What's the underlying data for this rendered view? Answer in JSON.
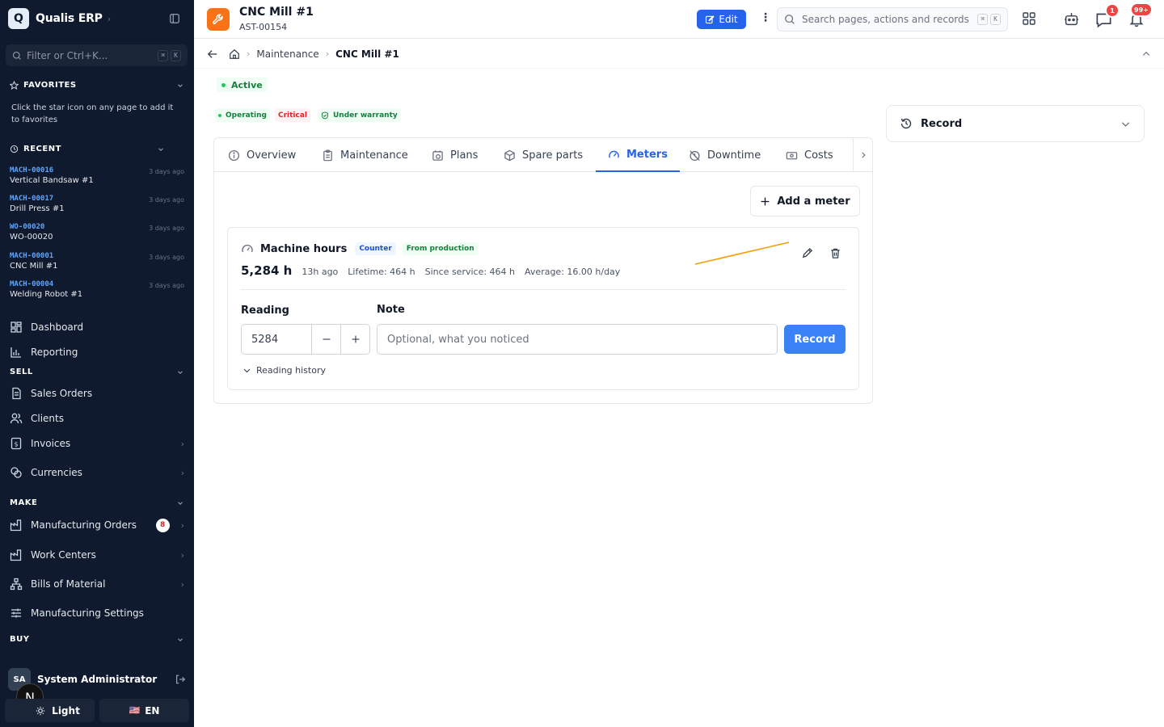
{
  "sidebar": {
    "app_name": "Qualis ERP",
    "logo_letter": "Q",
    "filter_placeholder": "Filter or Ctrl+K...",
    "filter_kbd": [
      "⌘",
      "K"
    ],
    "favorites": {
      "title": "FAVORITES",
      "hint": "Click the star icon on any page to add it to favorites"
    },
    "recent": {
      "title": "RECENT",
      "items": [
        {
          "code": "MACH-00016",
          "name": "Vertical Bandsaw #1",
          "time": "3 days ago"
        },
        {
          "code": "MACH-00017",
          "name": "Drill Press #1",
          "time": "3 days ago"
        },
        {
          "code": "WO-00020",
          "name": "WO-00020",
          "time": "3 days ago"
        },
        {
          "code": "MACH-00001",
          "name": "CNC Mill #1",
          "time": "3 days ago"
        },
        {
          "code": "MACH-00004",
          "name": "Welding Robot #1",
          "time": "3 days ago"
        }
      ]
    },
    "nav": {
      "dashboard": "Dashboard",
      "reporting": "Reporting"
    },
    "sell": {
      "title": "SELL",
      "sales_orders": "Sales Orders",
      "clients": "Clients",
      "invoices": "Invoices",
      "currencies": "Currencies"
    },
    "make": {
      "title": "MAKE",
      "manufacturing_orders": "Manufacturing Orders",
      "manufacturing_orders_badge": "8",
      "work_centers": "Work Centers",
      "bills_of_material": "Bills of Material",
      "manufacturing_settings": "Manufacturing Settings"
    },
    "buy": {
      "title": "BUY"
    },
    "user": {
      "initials": "SA",
      "name": "System Administrator"
    },
    "n_bubble": "N",
    "theme_label": "Light",
    "language_label": "EN",
    "language_flag": "🇺🇸"
  },
  "header": {
    "asset_title": "CNC Mill #1",
    "asset_code": "AST-00154",
    "edit_label": "Edit",
    "search_placeholder": "Search pages, actions and records",
    "search_kbd": [
      "⌘",
      "K"
    ],
    "messages_badge": "1",
    "notifications_badge": "99+"
  },
  "breadcrumb": {
    "items": [
      "Maintenance",
      "CNC Mill #1"
    ]
  },
  "status": {
    "main": "Active",
    "operating": "Operating",
    "criticality": "Critical",
    "warranty": "Under warranty"
  },
  "record_panel": {
    "title": "Record"
  },
  "tabs": [
    "Overview",
    "Maintenance",
    "Plans",
    "Spare parts",
    "Meters",
    "Downtime",
    "Costs"
  ],
  "active_tab": "Meters",
  "meters": {
    "add_label": "Add a meter",
    "meter": {
      "name": "Machine hours",
      "type_tag": "Counter",
      "source_tag": "From production",
      "value": "5,284 h",
      "updated": "13h ago",
      "lifetime": "Lifetime: 464 h",
      "since_service": "Since service: 464 h",
      "average": "Average: 16.00 h/day"
    },
    "form": {
      "reading_label": "Reading",
      "reading_value": "5284",
      "note_label": "Note",
      "note_placeholder": "Optional, what you noticed",
      "record_label": "Record"
    },
    "history_label": "Reading history"
  },
  "colors": {
    "sidebar_bg": "#0f1a2e",
    "primary": "#2563eb",
    "asset_icon": "#f97316",
    "sparkline": "#f59e0b",
    "success": "#15803d",
    "danger": "#dc2626"
  }
}
